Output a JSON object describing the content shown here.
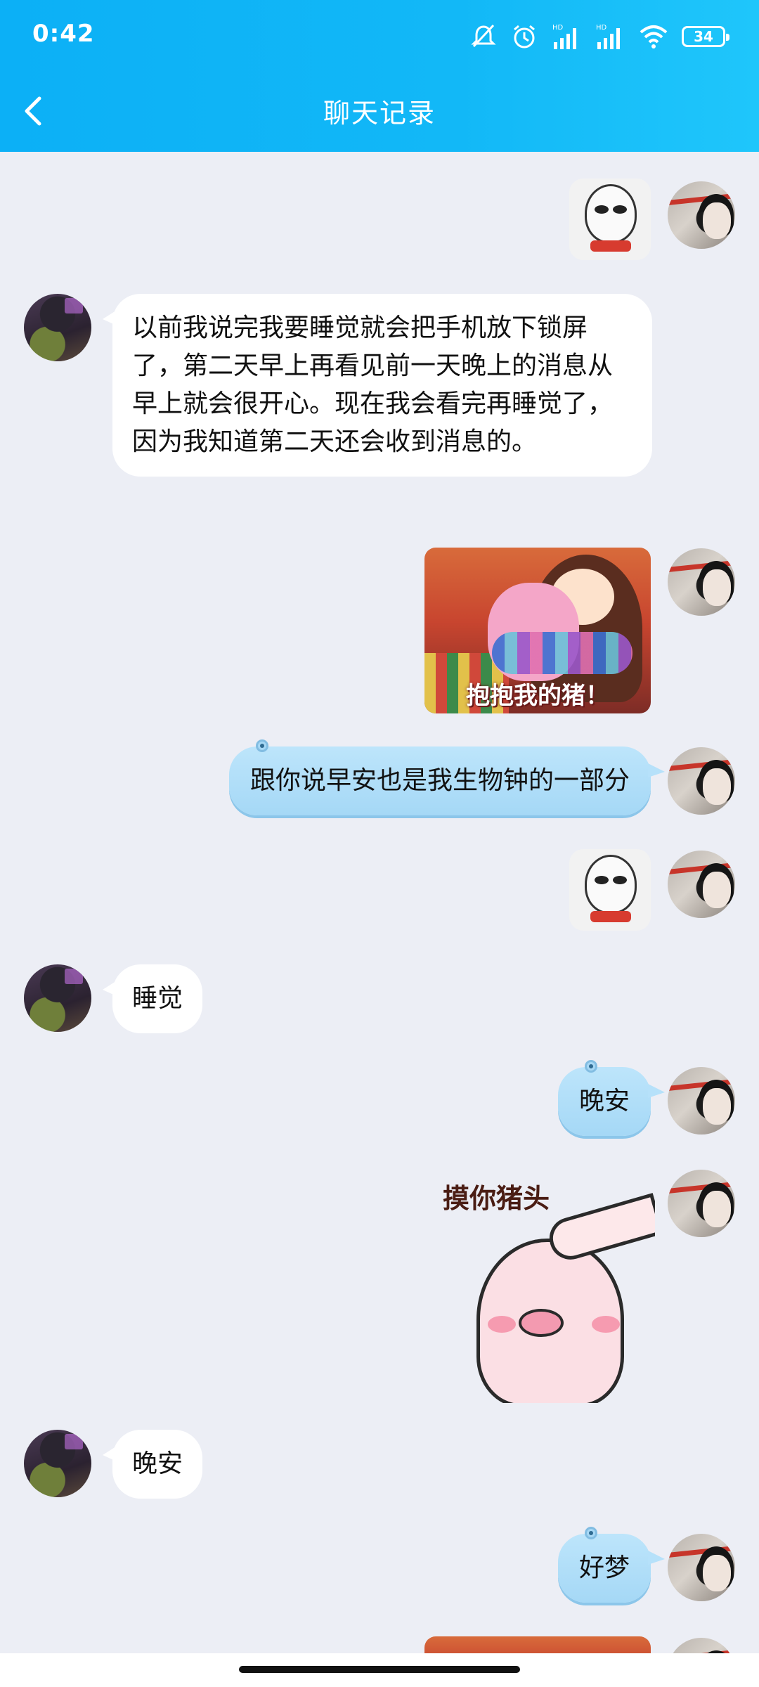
{
  "status_bar": {
    "time": "0:42",
    "battery": "34",
    "icons": [
      "mute-icon",
      "alarm-icon",
      "hd-signal-icon",
      "hd-signal-icon",
      "wifi-icon",
      "battery-icon"
    ]
  },
  "header": {
    "title": "聊天记录",
    "back_icon": "chevron-left-icon"
  },
  "messages": [
    {
      "side": "right",
      "type": "sticker",
      "sticker": "meme-face"
    },
    {
      "side": "left",
      "type": "text",
      "text": "以前我说完我要睡觉就会把手机放下锁屏了，第二天早上再看见前一天晚上的消息从早上就会很开心。现在我会看完再睡觉了，因为我知道第二天还会收到消息的。"
    },
    {
      "side": "right",
      "type": "sticker",
      "sticker": "hug-pig",
      "caption": "抱抱我的猪！"
    },
    {
      "side": "right",
      "type": "text",
      "text": "跟你说早安也是我生物钟的一部分"
    },
    {
      "side": "right",
      "type": "sticker",
      "sticker": "meme-face"
    },
    {
      "side": "left",
      "type": "text",
      "text": "睡觉"
    },
    {
      "side": "right",
      "type": "text",
      "text": "晚安"
    },
    {
      "side": "right",
      "type": "sticker",
      "sticker": "pat-pig",
      "caption": "摸你猪头"
    },
    {
      "side": "left",
      "type": "text",
      "text": "晚安"
    },
    {
      "side": "right",
      "type": "text",
      "text": "好梦"
    }
  ]
}
